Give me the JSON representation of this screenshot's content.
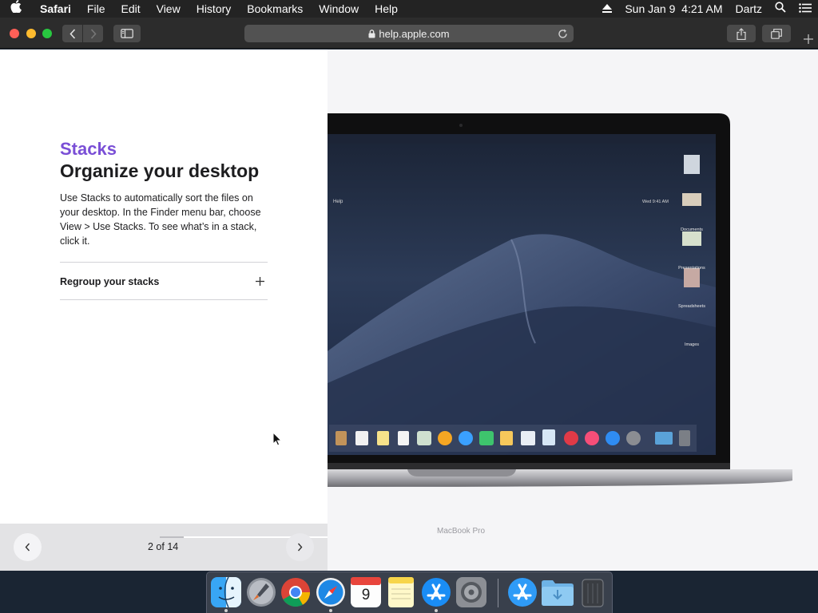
{
  "menubar": {
    "app_name": "Safari",
    "menus": [
      "File",
      "Edit",
      "View",
      "History",
      "Bookmarks",
      "Window",
      "Help"
    ],
    "datetime": "Sun Jan 9  4:21 AM",
    "user": "Dartz"
  },
  "toolbar": {
    "url": "help.apple.com"
  },
  "article": {
    "kicker": "Stacks",
    "heading": "Organize your desktop",
    "body": "Use Stacks to automatically sort the files on your desktop. In the Finder menu bar, choose View > Use Stacks. To see what’s in a stack, click it.",
    "accordion_label": "Regroup your stacks"
  },
  "gallery": {
    "counter": "2 of 14",
    "progress": 0.143
  },
  "illustration": {
    "device_label": "MacBook Pro",
    "mini_menu_app": "Help",
    "mini_clock": "Wed 9:41 AM",
    "desktop_stacks": [
      "Documents",
      "Presentations",
      "Spreadsheets",
      "Images"
    ]
  },
  "dock": {
    "apps": [
      "Finder",
      "Launchpad",
      "Chrome",
      "Safari",
      "Calendar",
      "Notes",
      "App Store",
      "System Preferences",
      "App Store",
      "Downloads",
      "Trash"
    ],
    "calendar_day": "9"
  },
  "colors": {
    "kicker": "#7a4fd6",
    "menubar": "#232323",
    "toolbar": "#2c2c2c"
  }
}
